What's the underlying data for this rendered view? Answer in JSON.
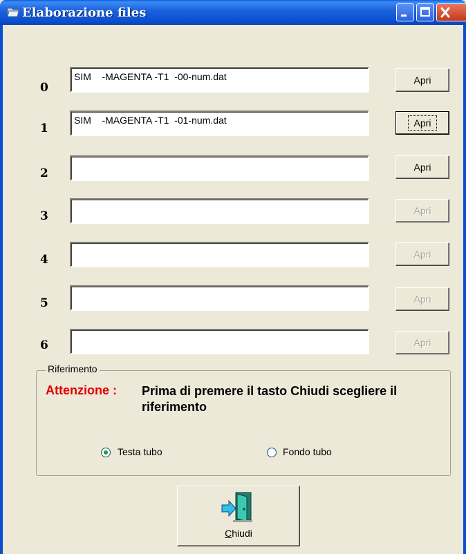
{
  "window": {
    "title": "Elaborazione files",
    "icons": {
      "app": "folder-app-icon",
      "minimize": "minimize-icon",
      "maximize": "maximize-icon",
      "close": "close-icon"
    }
  },
  "files": [
    {
      "index": "0",
      "value": "SIM    -MAGENTA -T1  -00-num.dat",
      "button": "Apri",
      "enabled": true
    },
    {
      "index": "1",
      "value": "SIM    -MAGENTA -T1  -01-num.dat",
      "button": "Apri",
      "enabled": true,
      "focused": true
    },
    {
      "index": "2",
      "value": "",
      "button": "Apri",
      "enabled": true
    },
    {
      "index": "3",
      "value": "",
      "button": "Apri",
      "enabled": false
    },
    {
      "index": "4",
      "value": "",
      "button": "Apri",
      "enabled": false
    },
    {
      "index": "5",
      "value": "",
      "button": "Apri",
      "enabled": false
    },
    {
      "index": "6",
      "value": "",
      "button": "Apri",
      "enabled": false
    }
  ],
  "riferimento": {
    "legend": "Riferimento",
    "warning_label": "Attenzione :",
    "warning_text": "Prima di premere il tasto Chiudi scegliere il riferimento",
    "options": [
      {
        "label": "Testa tubo",
        "selected": true
      },
      {
        "label": "Fondo tubo",
        "selected": false
      }
    ]
  },
  "close_button": {
    "label_first": "C",
    "label_rest": "hiudi",
    "icon": "exit-door-icon"
  },
  "colors": {
    "warning": "#e40000",
    "titlebar": "#0a4fd0",
    "dialog_bg": "#ece9d8"
  }
}
